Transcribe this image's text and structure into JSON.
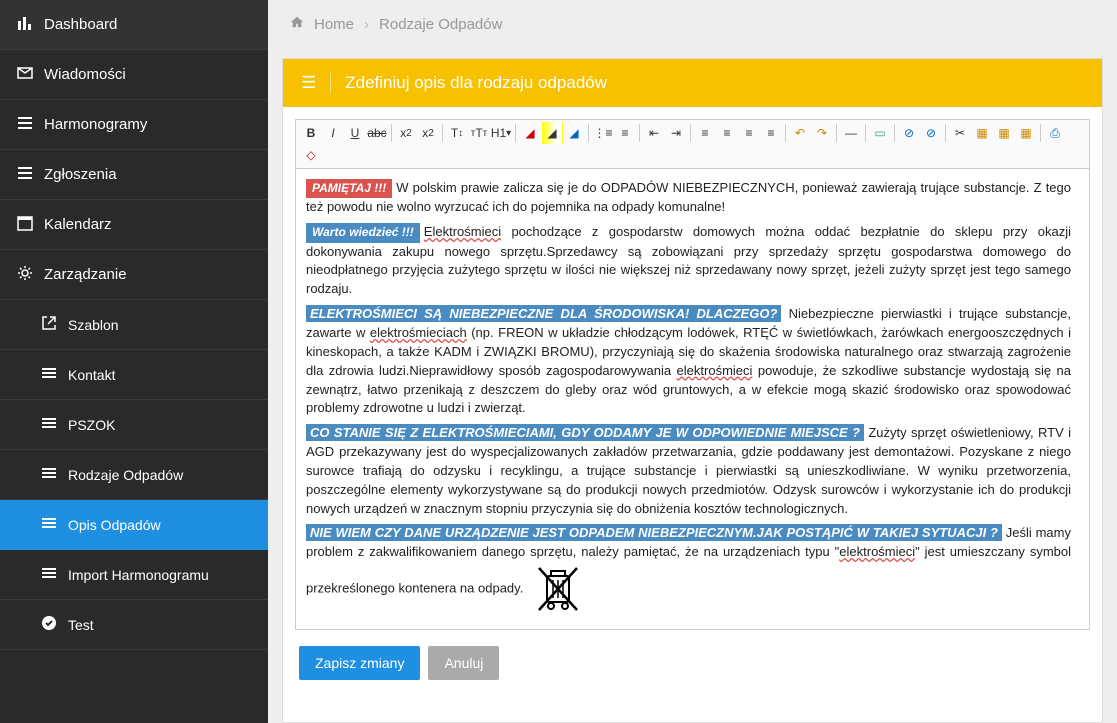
{
  "sidebar": {
    "items": [
      {
        "label": "Dashboard",
        "icon": "bar-chart"
      },
      {
        "label": "Wiadomości",
        "icon": "envelope"
      },
      {
        "label": "Harmonogramy",
        "icon": "list"
      },
      {
        "label": "Zgłoszenia",
        "icon": "list"
      },
      {
        "label": "Kalendarz",
        "icon": "calendar"
      },
      {
        "label": "Zarządzanie",
        "icon": "gear"
      }
    ],
    "sub": [
      {
        "label": "Szablon",
        "icon": "external"
      },
      {
        "label": "Kontakt",
        "icon": "list"
      },
      {
        "label": "PSZOK",
        "icon": "list"
      },
      {
        "label": "Rodzaje Odpadów",
        "icon": "list"
      },
      {
        "label": "Opis Odpadów",
        "icon": "list",
        "active": true
      },
      {
        "label": "Import Harmonogramu",
        "icon": "list"
      },
      {
        "label": "Test",
        "icon": "check"
      }
    ]
  },
  "breadcrumb": {
    "home": "Home",
    "current": "Rodzaje Odpadów"
  },
  "panel": {
    "title": "Zdefiniuj opis dla rodzaju odpadów"
  },
  "buttons": {
    "save": "Zapisz zmiany",
    "cancel": "Anuluj"
  },
  "content": {
    "badge_remember": "PAMIĘTAJ !!!",
    "p1": "W polskim prawie zalicza się je do ODPADÓW NIEBEZPIECZNYCH, ponieważ zawierają trujące substancje. Z tego też powodu nie wolno wyrzucać ich do pojemnika na odpady komunalne!",
    "badge_know": "Warto wiedzieć !!!",
    "p2a": "Elektrośmieci",
    "p2b": " pochodzące z gospodarstw domowych można oddać bezpłatnie do sklepu przy okazji dokonywania zakupu nowego sprzętu.Sprzedawcy są zobowiązani przy sprzedaży sprzętu gospodarstwa domowego do nieodpłatnego przyjęcia zużytego sprzętu w ilości nie większej niż sprzedawany nowy sprzęt, jeżeli zużyty sprzęt jest tego samego rodzaju.",
    "hl1": "ELEKTROŚMIECI SĄ NIEBEZPIECZNE DLA ŚRODOWISKA! DLACZEGO?",
    "p3a": " Niebezpieczne pierwiastki i trujące substancje, zawarte w ",
    "p3b": "elektrośmieciach",
    "p3c": " (np. FREON w układzie chłodzącym lodówek, RTĘĆ w świetlówkach, żarówkach energooszczędnych i kineskopach, a także KADM i ZWIĄZKI BROMU), przyczyniają się do skażenia środowiska naturalnego oraz stwarzają zagrożenie dla zdrowia ludzi.Nieprawidłowy sposób zagospodarowywania ",
    "p3d": "elektrośmieci",
    "p3e": " powoduje, że szkodliwe substancje wydostają się na zewnątrz, łatwo przenikają z deszczem do gleby oraz wód gruntowych, a w efekcie mogą skazić środowisko oraz spowodować problemy zdrowotne u ludzi i zwierząt.",
    "hl2": "CO STANIE SIĘ Z ELEKTROŚMIECIAMI, GDY ODDAMY JE W ODPOWIEDNIE MIEJSCE ?",
    "p4": " Zużyty sprzęt oświetleniowy, RTV i AGD przekazywany jest do wyspecjalizowanych zakładów przetwarzania, gdzie poddawany jest demontażowi. Pozyskane z niego surowce trafiają do odzysku i recyklingu, a trujące substancje i pierwiastki są unieszkodliwiane. W wyniku przetworzenia, poszczególne elementy wykorzystywane są do produkcji nowych przedmiotów. Odzysk surowców i wykorzystanie ich do produkcji nowych urządzeń w znacznym stopniu przyczynia się do obniżenia kosztów technologicznych.",
    "hl3": "NIE WIEM CZY DANE URZĄDZENIE JEST ODPADEM NIEBEZPIECZNYM.JAK POSTĄPIĆ W TAKIEJ SYTUACJI ?",
    "p5a": " Jeśli mamy problem z zakwalifikowaniem danego sprzętu, należy pamiętać, że na urządzeniach typu \"",
    "p5b": "elektrośmieci",
    "p5c": "\" jest umieszczany symbol przekreślonego kontenera na odpady.",
    "toolbar_icons": [
      "B",
      "I",
      "U",
      "abc",
      "x₂",
      "x²",
      "T↕",
      "₸T",
      "H1",
      "⁋",
      "⁋",
      "⁋",
      "•",
      "•",
      "⇤",
      "⇥",
      "≡",
      "≡",
      "≡",
      "≡",
      "↶",
      "↷",
      "—",
      "▭",
      "⊡",
      "⊡",
      "✂",
      "▦",
      "▦",
      "▦",
      "⎙",
      "⎘"
    ]
  }
}
